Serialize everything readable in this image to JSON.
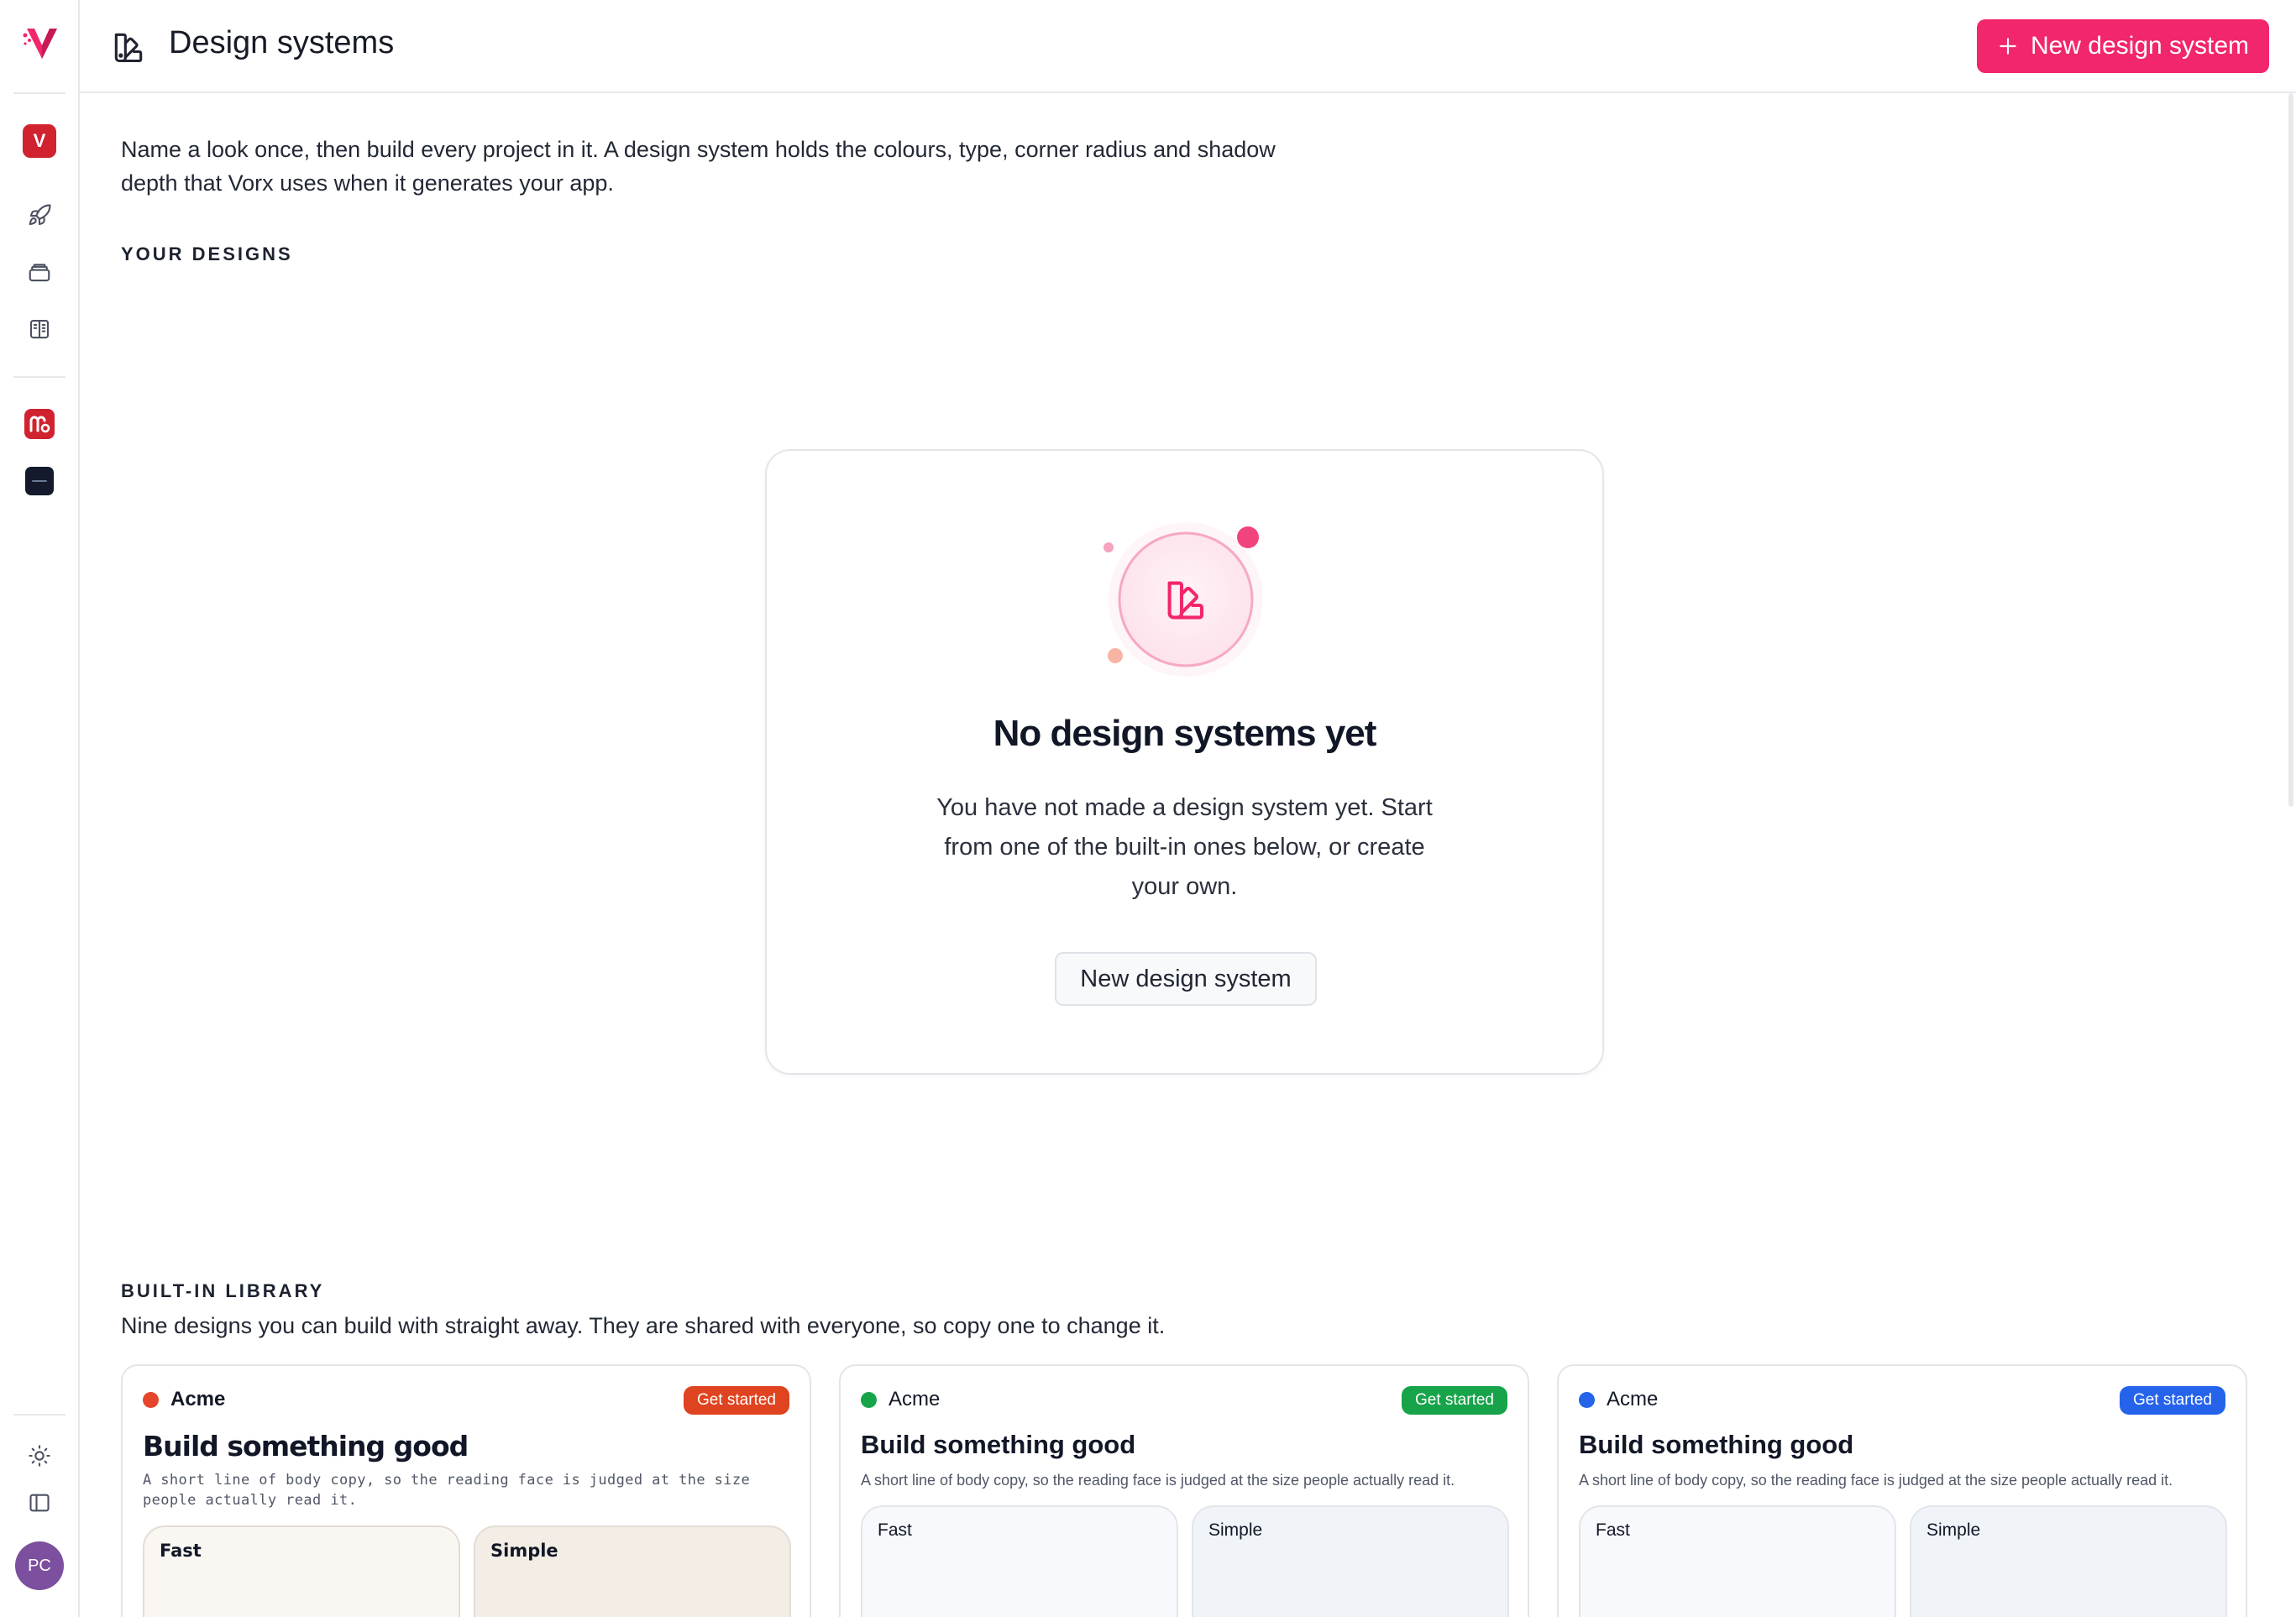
{
  "sidebar": {
    "logo": "vorx-logo",
    "workspace_badge": "V",
    "nav_icons": [
      "rocket-icon",
      "layers-icon",
      "book-icon"
    ],
    "app_icons": [
      "app-logo-red",
      "app-logo-dark"
    ],
    "bottom_icons": [
      "sun-icon",
      "sidebar-toggle-icon"
    ],
    "avatar_initials": "PC",
    "brand_color": "#f2266c",
    "workspace_color": "#d0232f",
    "avatar_color": "#7c4f9f"
  },
  "header": {
    "title": "Design systems",
    "icon": "swatch-icon",
    "new_button_label": "New design system"
  },
  "intro": "Name a look once, then build every project in it. A design system holds the colours, type, corner radius and shadow depth that Vorx uses when it generates your app.",
  "your_designs": {
    "title": "YOUR DESIGNS",
    "empty": {
      "title": "No design systems yet",
      "text": "You have not made a design system yet. Start from one of the built-in ones below, or create your own.",
      "button_label": "New design system"
    }
  },
  "library": {
    "title": "BUILT-IN LIBRARY",
    "subtitle": "Nine designs you can build with straight away. They are shared with everyone, so copy one to change it.",
    "cards": [
      {
        "brand": "Acme",
        "dot_color": "#e4452b",
        "badge": "Get started",
        "badge_color": "#e0431f",
        "heading": "Build something good",
        "body": "A short line of body copy, so the reading face is judged at the size people actually read it.",
        "tiles": [
          "Fast",
          "Simple"
        ]
      },
      {
        "brand": "Acme",
        "dot_color": "#16a34a",
        "badge": "Get started",
        "badge_color": "#16a34a",
        "heading": "Build something good",
        "body": "A short line of body copy, so the reading face is judged at the size people actually read it.",
        "tiles": [
          "Fast",
          "Simple"
        ]
      },
      {
        "brand": "Acme",
        "dot_color": "#2563eb",
        "badge": "Get started",
        "badge_color": "#2563eb",
        "heading": "Build something good",
        "body": "A short line of body copy, so the reading face is judged at the size people actually read it.",
        "tiles": [
          "Fast",
          "Simple"
        ]
      }
    ]
  }
}
